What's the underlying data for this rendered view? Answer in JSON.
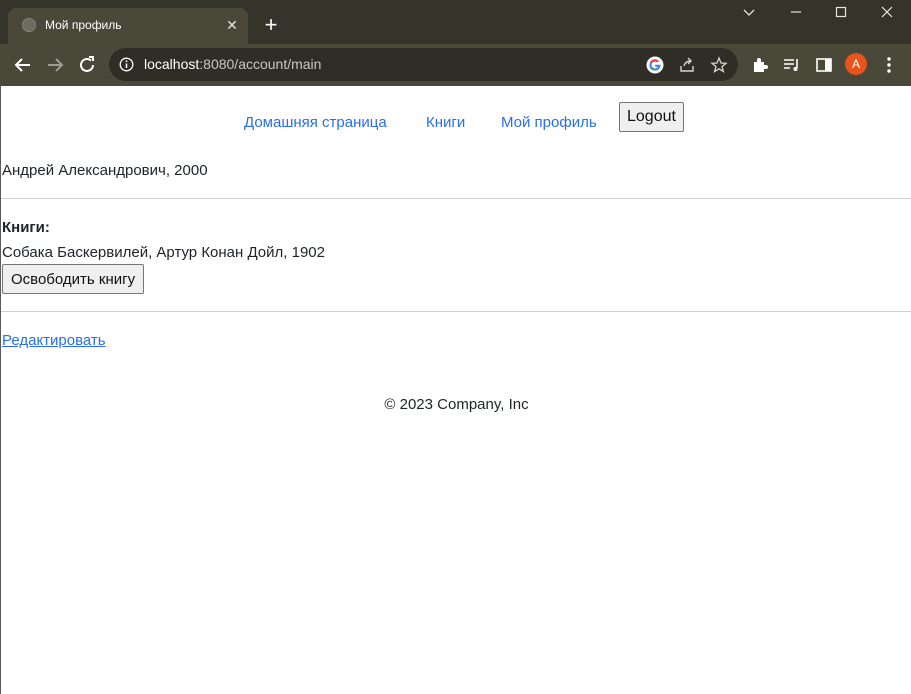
{
  "browser": {
    "tab_title": "Мой профиль",
    "url_host": "localhost",
    "url_rest": ":8080/account/main",
    "profile_initial": "A",
    "accent_color": "#e8541e"
  },
  "nav": {
    "home": "Домашняя страница",
    "books": "Книги",
    "profile": "Мой профиль",
    "logout": "Logout"
  },
  "owner": {
    "line": "Андрей Александрович, 2000"
  },
  "books": {
    "label": "Книги:",
    "items": [
      {
        "line": "Собака Баскервилей, Артур Конан Дойл, 1902",
        "release_label": "Освободить книгу"
      }
    ]
  },
  "edit_link": "Редактировать",
  "footer": "© 2023 Company, Inc",
  "link_color": "#2a6ef0"
}
